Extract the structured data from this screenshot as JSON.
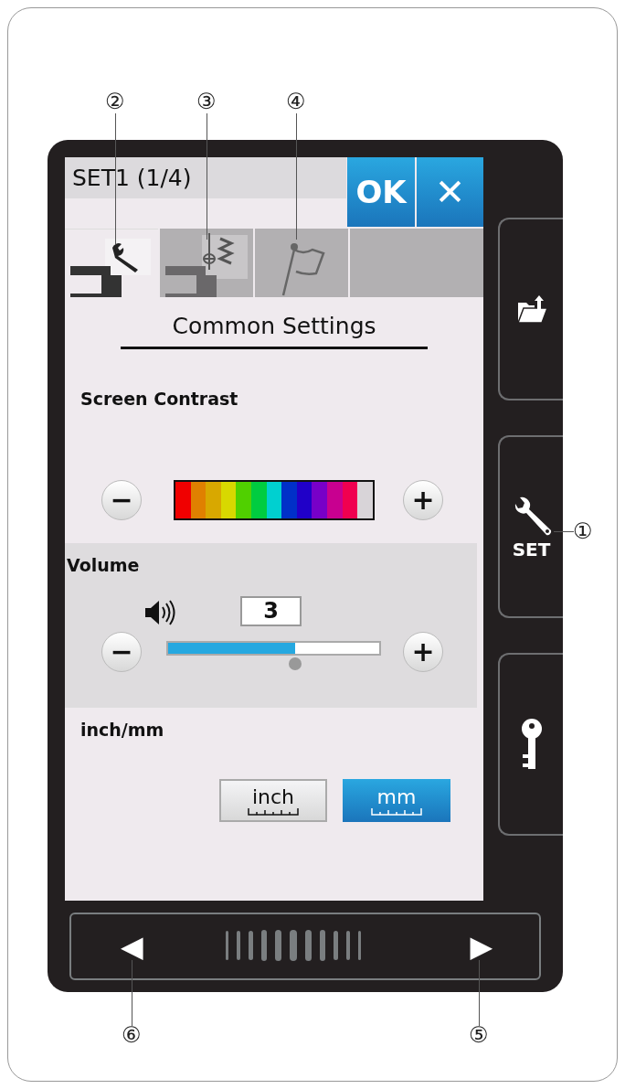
{
  "header": {
    "title": "SET1 (1/4)",
    "ok_button": "OK",
    "close_button": "✕"
  },
  "tabs": [
    {
      "kind": "common",
      "selected": true
    },
    {
      "kind": "sewing",
      "selected": false
    },
    {
      "kind": "language",
      "selected": false
    }
  ],
  "heading": "Common Settings",
  "screen_contrast": {
    "label": "Screen Contrast",
    "minus": "−",
    "plus": "+"
  },
  "volume": {
    "label": "Volume",
    "value": "3",
    "level": 0.6,
    "minus": "−",
    "plus": "+"
  },
  "units": {
    "label": "inch/mm",
    "options": [
      {
        "label": "inch",
        "selected": false
      },
      {
        "label": "mm",
        "selected": true
      }
    ]
  },
  "side_buttons": [
    {
      "kind": "folder"
    },
    {
      "kind": "set",
      "label": "SET"
    },
    {
      "kind": "key"
    }
  ],
  "nav": {
    "prev": "◀",
    "next": "▶"
  },
  "callouts": [
    "①",
    "②",
    "③",
    "④",
    "⑤",
    "⑥"
  ]
}
